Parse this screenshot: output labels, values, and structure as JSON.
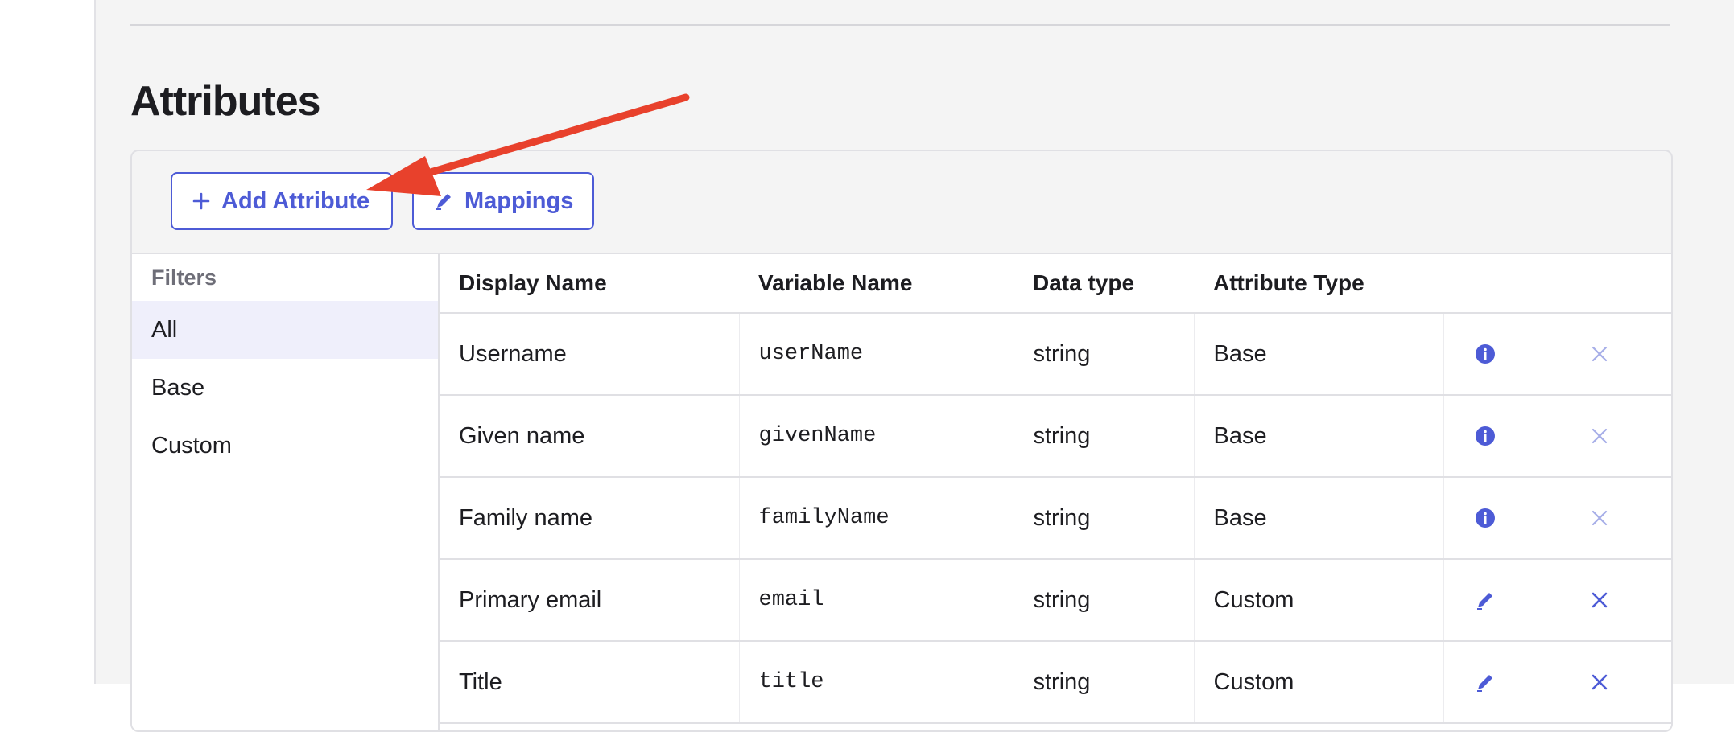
{
  "section": {
    "title": "Attributes"
  },
  "toolbar": {
    "add_label": "Add Attribute",
    "mappings_label": "Mappings"
  },
  "filters": {
    "title": "Filters",
    "items": [
      {
        "label": "All",
        "active": true
      },
      {
        "label": "Base",
        "active": false
      },
      {
        "label": "Custom",
        "active": false
      }
    ]
  },
  "table": {
    "headers": {
      "display_name": "Display Name",
      "variable_name": "Variable Name",
      "data_type": "Data type",
      "attribute_type": "Attribute Type"
    },
    "rows": [
      {
        "display_name": "Username",
        "variable_name": "userName",
        "data_type": "string",
        "attribute_type": "Base",
        "action_icon": "info-icon"
      },
      {
        "display_name": "Given name",
        "variable_name": "givenName",
        "data_type": "string",
        "attribute_type": "Base",
        "action_icon": "info-icon"
      },
      {
        "display_name": "Family name",
        "variable_name": "familyName",
        "data_type": "string",
        "attribute_type": "Base",
        "action_icon": "info-icon"
      },
      {
        "display_name": "Primary email",
        "variable_name": "email",
        "data_type": "string",
        "attribute_type": "Custom",
        "action_icon": "pencil-icon"
      },
      {
        "display_name": "Title",
        "variable_name": "title",
        "data_type": "string",
        "attribute_type": "Custom",
        "action_icon": "pencil-icon"
      }
    ]
  },
  "colors": {
    "accent": "#4d5bd6",
    "annotation_arrow": "#e8412c",
    "disabled_icon": "#a7aee8"
  }
}
